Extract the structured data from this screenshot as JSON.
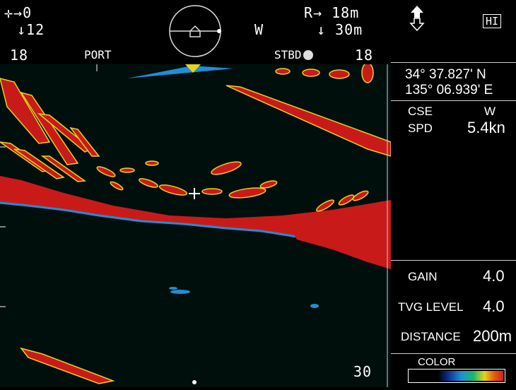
{
  "header": {
    "cursor_h": "→0",
    "cursor_v": "↓12",
    "range_h": "R→ 18m",
    "heading": "W",
    "range_v": "↓ 30m",
    "scale_left": "18",
    "port": "PORT",
    "stbd": "STBD",
    "scale_right": "18"
  },
  "sonar": {
    "depth_marker": "30"
  },
  "panel": {
    "mode": "HI",
    "lat": "34° 37.827' N",
    "lon": "135° 06.939' E",
    "cse_label": "CSE",
    "cse_value": "W",
    "spd_label": "SPD",
    "spd_value": "5.4kn",
    "gain_label": "GAIN",
    "gain_value": "4.0",
    "tvg_label": "TVG LEVEL",
    "tvg_value": "4.0",
    "distance_label": "DISTANCE",
    "distance_value": "200m",
    "color_label": "COLOR"
  },
  "colors": {
    "echo_strong": "#d21f1f",
    "echo_mid": "#e8d21a",
    "echo_low": "#1f8fd6",
    "echo_weak": "#19b86a",
    "background": "#010f0c"
  }
}
